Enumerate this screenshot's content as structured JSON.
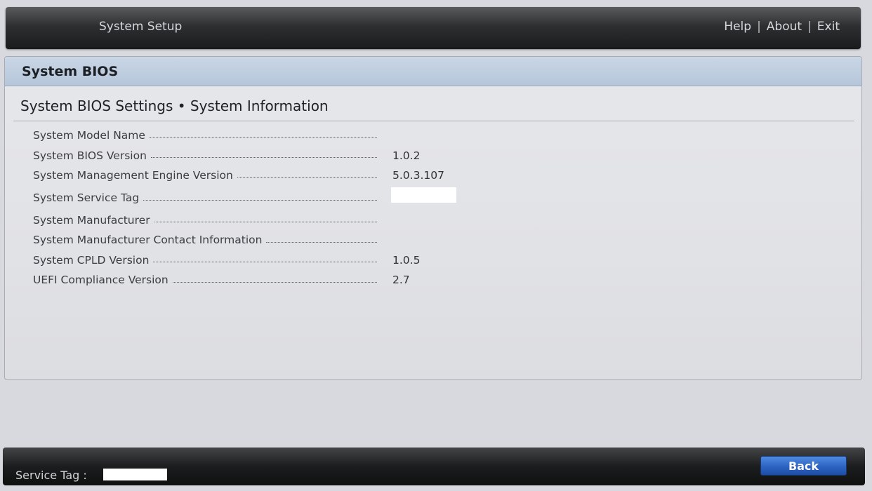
{
  "topbar": {
    "title": "System Setup",
    "links": [
      "Help",
      "About",
      "Exit"
    ],
    "separator": "|"
  },
  "panel": {
    "header": "System BIOS",
    "page_title": "System BIOS Settings • System Information"
  },
  "rows": [
    {
      "label": "System Model Name",
      "value": ""
    },
    {
      "label": "System BIOS Version",
      "value": "1.0.2"
    },
    {
      "label": "System Management Engine Version",
      "value": "5.0.3.107"
    },
    {
      "label": "System Service Tag",
      "value": ""
    },
    {
      "label": "System Manufacturer",
      "value": ""
    },
    {
      "label": "System Manufacturer Contact Information",
      "value": ""
    },
    {
      "label": "System CPLD Version",
      "value": "1.0.5"
    },
    {
      "label": "UEFI Compliance Version",
      "value": "2.7"
    }
  ],
  "footer": {
    "service_tag_label": "Service Tag :",
    "back_label": "Back"
  }
}
